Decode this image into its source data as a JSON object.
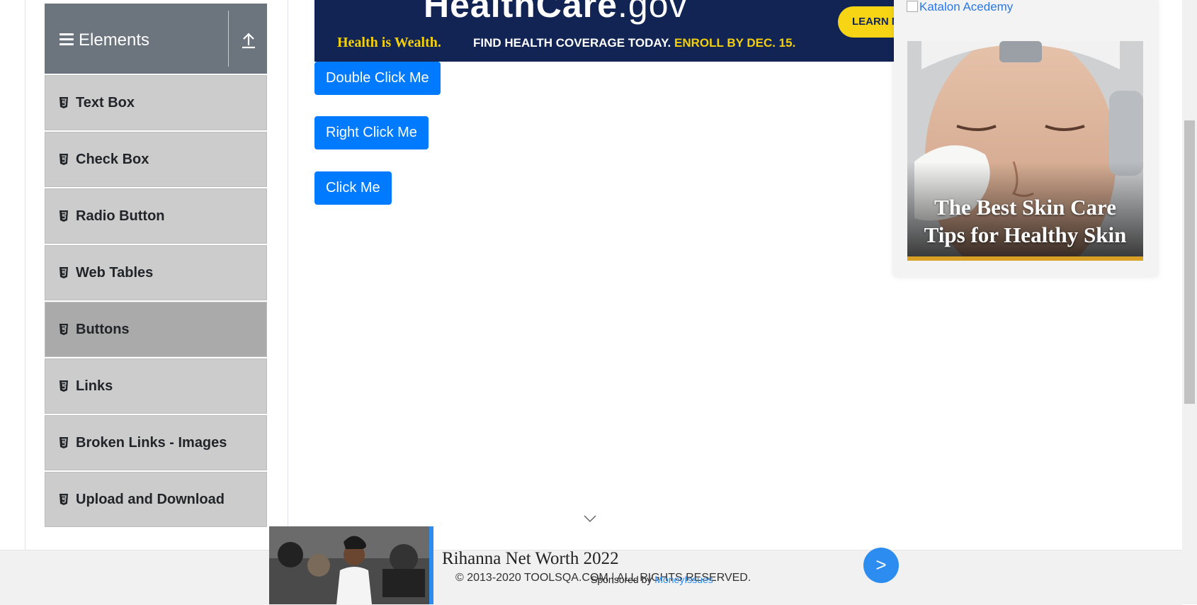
{
  "sidebar": {
    "group_title": "Elements",
    "items": [
      {
        "label": "Text Box"
      },
      {
        "label": "Check Box"
      },
      {
        "label": "Radio Button"
      },
      {
        "label": "Web Tables"
      },
      {
        "label": "Buttons",
        "active": true
      },
      {
        "label": "Links"
      },
      {
        "label": "Broken Links - Images"
      },
      {
        "label": "Upload and Download"
      }
    ]
  },
  "banner": {
    "brand": "HealthCare",
    "brand_suffix": ".gov",
    "tagline": "Health is Wealth.",
    "find": "FIND HEALTH COVERAGE TODAY.",
    "enroll": "ENROLL BY DEC. 15.",
    "cta": "LEARN M"
  },
  "buttons": {
    "double_click": "Double Click Me",
    "right_click": "Right Click Me",
    "click": "Click Me"
  },
  "right_ad": {
    "link_text": "Katalon Acedemy",
    "caption_line1": "The Best Skin Care",
    "caption_line2": "Tips for Healthy Skin"
  },
  "footer": {
    "copyright": "© 2013-2020 TOOLSQA.COM | ALL RIGHTS RESERVED."
  },
  "bottom_ad": {
    "headline": "Rihanna Net Worth 2022",
    "sponsored_by": "Sponsored by",
    "sponsor_name": "MoneyIssues",
    "go_label": ">"
  },
  "colors": {
    "primary_button": "#007bff",
    "sidebar_header": "#6c757d",
    "sidebar_item": "#cccccc",
    "sidebar_item_active": "#aaaaaa",
    "banner_navy": "#112454",
    "banner_yellow": "#f3d00b"
  }
}
